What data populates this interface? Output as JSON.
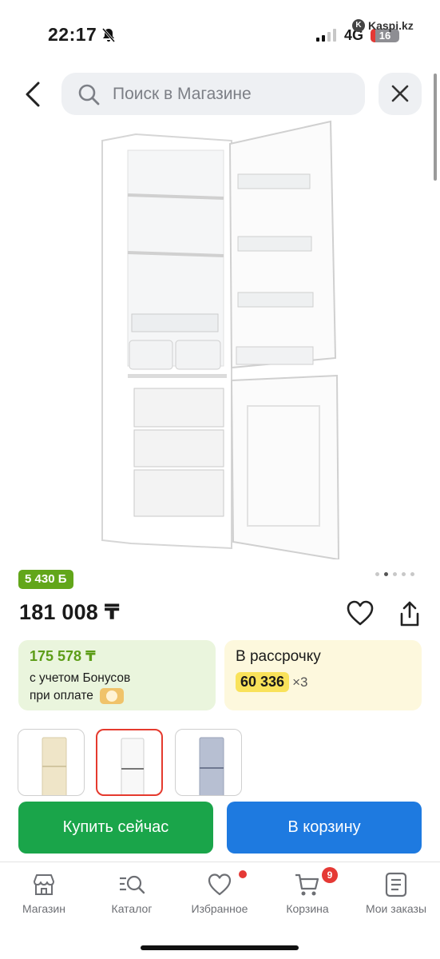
{
  "status_bar": {
    "time": "22:17",
    "network": "4G",
    "battery": "16",
    "battery_level": 0.16,
    "source": "Kaspi.kz"
  },
  "search": {
    "placeholder": "Поиск в Магазине"
  },
  "gallery": {
    "total_images": 5,
    "active_index": 1
  },
  "product": {
    "bonus_badge": "5 430 Б",
    "price": "181 008 ₸"
  },
  "bonus_card": {
    "amount": "175 578 ₸",
    "line1": "с учетом Бонусов",
    "line2": "при оплате"
  },
  "credit_card": {
    "title": "В рассрочку",
    "monthly": "60 336",
    "multiplier": "×3"
  },
  "variants": [
    {
      "color": "beige",
      "selected": false
    },
    {
      "color": "white",
      "selected": true
    },
    {
      "color": "silver",
      "selected": false
    }
  ],
  "actions": {
    "buy_now": "Купить сейчас",
    "to_cart": "В корзину"
  },
  "colors": {
    "green": "#1aa54a",
    "blue": "#1e7ae0",
    "red": "#e53935",
    "bonus_green": "#62a61a",
    "yellow": "#f9e25a"
  },
  "tabbar": {
    "items": [
      {
        "label": "Магазин",
        "icon": "store-icon"
      },
      {
        "label": "Каталог",
        "icon": "catalog-search-icon"
      },
      {
        "label": "Избранное",
        "icon": "heart-icon",
        "dot": true
      },
      {
        "label": "Корзина",
        "icon": "cart-icon",
        "badge": "9"
      },
      {
        "label": "Мои заказы",
        "icon": "orders-icon"
      }
    ]
  }
}
